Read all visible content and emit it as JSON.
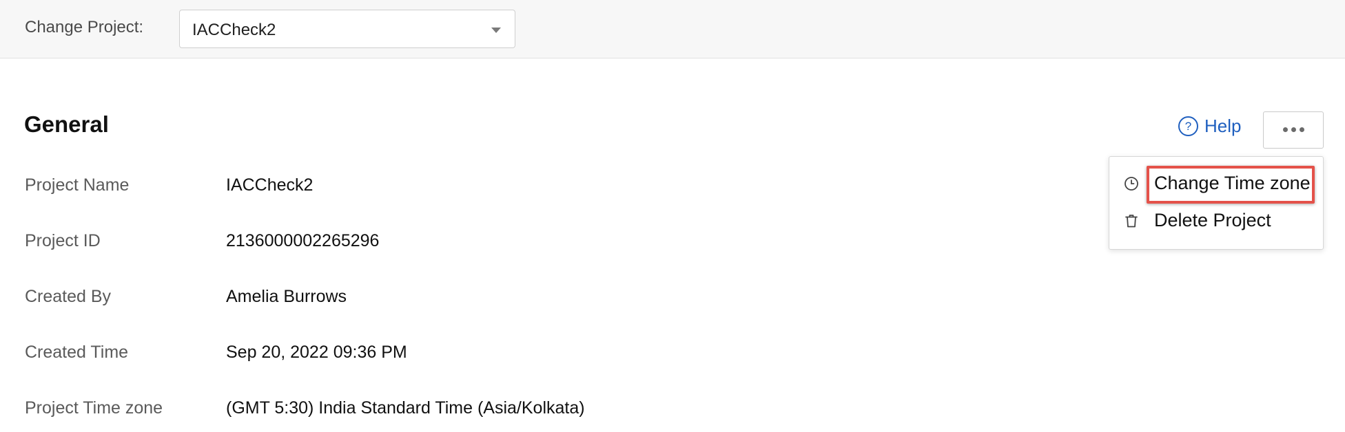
{
  "topbar": {
    "label": "Change Project:",
    "selected_project": "IACCheck2"
  },
  "section": {
    "title": "General",
    "help_label": "Help"
  },
  "menu": {
    "items": [
      {
        "label": "Change Time zone",
        "icon": "clock-icon",
        "highlighted": true
      },
      {
        "label": "Delete Project",
        "icon": "trash-icon",
        "highlighted": false
      }
    ]
  },
  "details": [
    {
      "label": "Project Name",
      "value": "IACCheck2"
    },
    {
      "label": "Project ID",
      "value": "2136000002265296"
    },
    {
      "label": "Created By",
      "value": "Amelia Burrows"
    },
    {
      "label": "Created Time",
      "value": "Sep 20, 2022 09:36 PM"
    },
    {
      "label": "Project Time zone",
      "value": "(GMT 5:30) India Standard Time (Asia/Kolkata)"
    }
  ],
  "colors": {
    "link": "#1f5fbf",
    "highlight": "#e4524a"
  }
}
